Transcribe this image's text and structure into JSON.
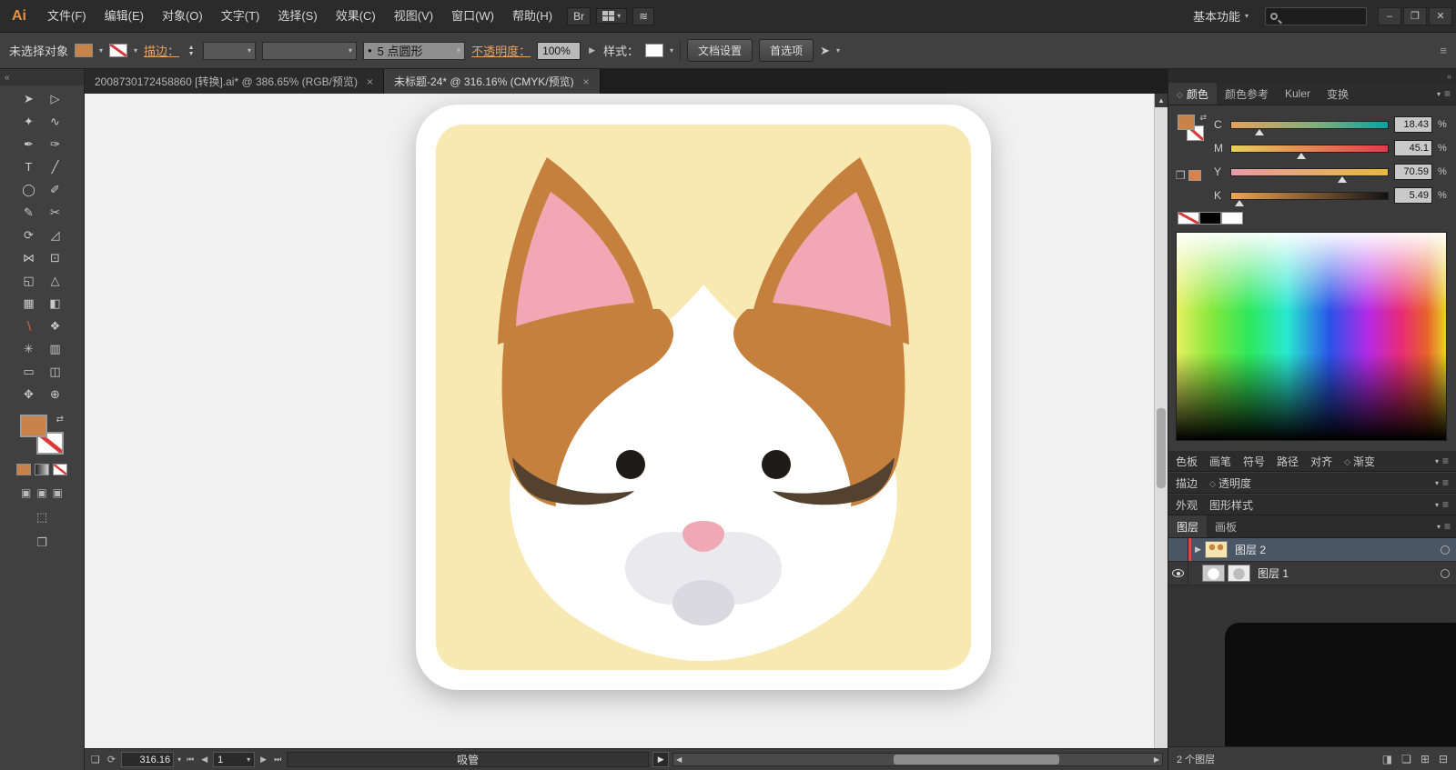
{
  "titlebar": {
    "logo": "Ai",
    "menus": [
      "文件(F)",
      "编辑(E)",
      "对象(O)",
      "文字(T)",
      "选择(S)",
      "效果(C)",
      "视图(V)",
      "窗口(W)",
      "帮助(H)"
    ],
    "bridge_label": "Br",
    "workspace": "基本功能",
    "window": {
      "minimize": "–",
      "maximize": "❐",
      "close": "✕"
    }
  },
  "controlbar": {
    "selection_status": "未选择对象",
    "stroke_label": "描边：",
    "brush_preset": "5 点圆形",
    "opacity_label": "不透明度：",
    "opacity_value": "100%",
    "style_label": "样式：",
    "doc_setup": "文档设置",
    "preferences": "首选项"
  },
  "doc_tabs": [
    {
      "title": "2008730172458860 [转换].ai* @ 386.65% (RGB/预览)",
      "close": "×"
    },
    {
      "title": "未标题-24* @ 316.16% (CMYK/预览)",
      "close": "×"
    }
  ],
  "color_panel": {
    "tabs": [
      "颜色",
      "颜色参考",
      "Kuler",
      "变换"
    ],
    "channels": [
      {
        "label": "C",
        "value": "18.43",
        "unit": "%"
      },
      {
        "label": "M",
        "value": "45.1",
        "unit": "%"
      },
      {
        "label": "Y",
        "value": "70.59",
        "unit": "%"
      },
      {
        "label": "K",
        "value": "5.49",
        "unit": "%"
      }
    ]
  },
  "dock": {
    "row1": [
      "色板",
      "画笔",
      "符号",
      "路径",
      "对齐",
      "渐变"
    ],
    "row2": [
      "描边",
      "透明度"
    ],
    "row3": [
      "外观",
      "图形样式"
    ]
  },
  "layers_panel": {
    "tabs": [
      "图层",
      "画板"
    ],
    "layers": [
      {
        "name": "图层 2"
      },
      {
        "name": "图层 1"
      }
    ],
    "count": "2 个图层"
  },
  "statusbar": {
    "zoom": "316.16",
    "artboard": "1",
    "tool": "吸管"
  },
  "colors": {
    "fill_orange": "#c8834a",
    "link_orange": "#e8a262",
    "selected_layer_row": "#4a5663"
  },
  "artwork": {
    "card": "#ffffff",
    "background": "#f8e9b2",
    "fur_white": "#ffffff",
    "patch_orange": "#c5803e",
    "ear_pink": "#f2a7b5",
    "stripe_dark": "#52422f",
    "eye_black": "#1f1b18",
    "nose_pink": "#f0a9b4",
    "muzzle_gray": "#e9e9ee",
    "chin_gray": "#d9d9df"
  }
}
